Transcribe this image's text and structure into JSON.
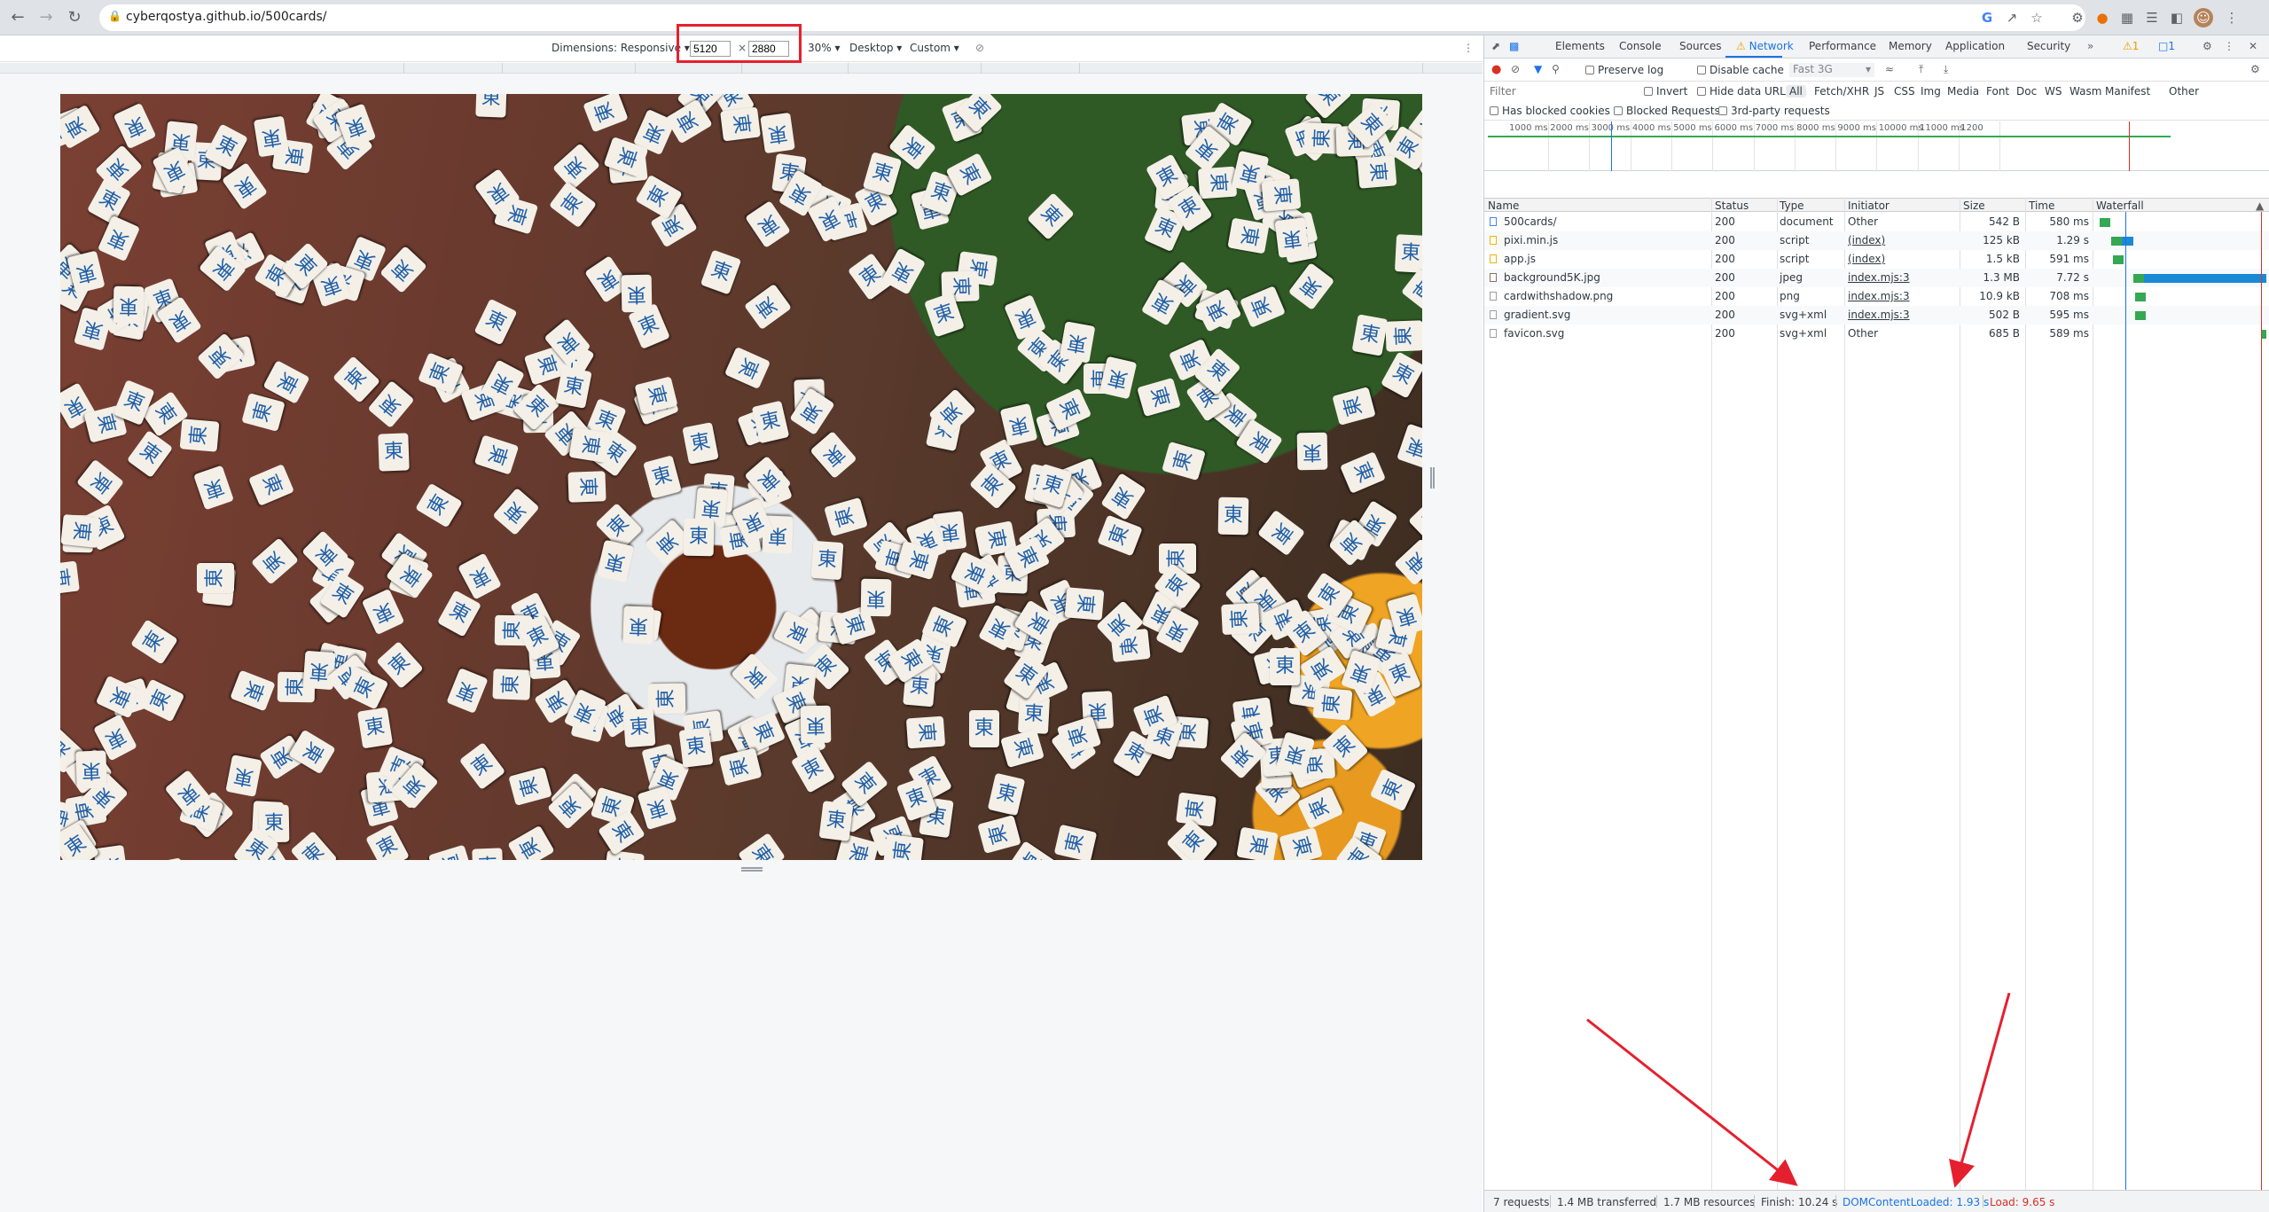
{
  "browser": {
    "url": "cyberqostya.github.io/500cards/"
  },
  "device_toolbar": {
    "dimensions_label": "Dimensions: Responsive ▾",
    "width": "5120",
    "height": "2880",
    "times": "×",
    "zoom": "30% ▾",
    "device_type": "Desktop ▾",
    "throttle": "Custom ▾"
  },
  "page": {
    "tile_glyph": "東",
    "background_colors": {
      "table": "#6a3a2e",
      "tile": "#f4f0e8",
      "glyph": "#1f5fa8"
    }
  },
  "devtools": {
    "tabs": [
      "Elements",
      "Console",
      "Sources",
      "Network",
      "Performance",
      "Memory",
      "Application",
      "Security"
    ],
    "active_tab": "Network",
    "warning_count": "1",
    "message_count": "1",
    "preserve_log": "Preserve log",
    "disable_cache": "Disable cache",
    "throttling": "Fast 3G",
    "filter_placeholder": "Filter",
    "invert": "Invert",
    "hide_data_urls": "Hide data URLs",
    "type_filters": [
      "All",
      "Fetch/XHR",
      "JS",
      "CSS",
      "Img",
      "Media",
      "Font",
      "Doc",
      "WS",
      "Wasm",
      "Manifest",
      "Other"
    ],
    "has_blocked_cookies": "Has blocked cookies",
    "blocked_requests": "Blocked Requests",
    "third_party": "3rd-party requests",
    "overview_ticks": [
      "1000 ms",
      "2000 ms",
      "3000 ms",
      "4000 ms",
      "5000 ms",
      "6000 ms",
      "7000 ms",
      "8000 ms",
      "9000 ms",
      "10000 ms",
      "11000 ms",
      "1200"
    ],
    "columns": [
      "Name",
      "Status",
      "Type",
      "Initiator",
      "Size",
      "Time",
      "Waterfall"
    ],
    "requests": [
      {
        "name": "500cards/",
        "status": "200",
        "type": "document",
        "initiator": "Other",
        "size": "542 B",
        "time": "580 ms",
        "icon_color": "#4285f4",
        "wf_start": 0.02,
        "wf_end": 0.09
      },
      {
        "name": "pixi.min.js",
        "status": "200",
        "type": "script",
        "initiator": "(index)",
        "size": "125 kB",
        "time": "1.29 s",
        "icon_color": "#f4b400",
        "wf_start": 0.09,
        "wf_end": 0.22
      },
      {
        "name": "app.js",
        "status": "200",
        "type": "script",
        "initiator": "(index)",
        "size": "1.5 kB",
        "time": "591 ms",
        "icon_color": "#f4b400",
        "wf_start": 0.1,
        "wf_end": 0.16
      },
      {
        "name": "background5K.jpg",
        "status": "200",
        "type": "jpeg",
        "initiator": "index.mjs:3",
        "size": "1.3 MB",
        "time": "7.72 s",
        "icon_color": "#8d6e63",
        "wf_start": 0.22,
        "wf_end": 1.0
      },
      {
        "name": "cardwithshadow.png",
        "status": "200",
        "type": "png",
        "initiator": "index.mjs:3",
        "size": "10.9 kB",
        "time": "708 ms",
        "icon_color": "#9e9e9e",
        "wf_start": 0.23,
        "wf_end": 0.3
      },
      {
        "name": "gradient.svg",
        "status": "200",
        "type": "svg+xml",
        "initiator": "index.mjs:3",
        "size": "502 B",
        "time": "595 ms",
        "icon_color": "#9e9e9e",
        "wf_start": 0.23,
        "wf_end": 0.29
      },
      {
        "name": "favicon.svg",
        "status": "200",
        "type": "svg+xml",
        "initiator": "Other",
        "size": "685 B",
        "time": "589 ms",
        "icon_color": "#9e9e9e",
        "wf_start": 0.97,
        "wf_end": 1.0
      }
    ],
    "status_bar": {
      "requests": "7 requests",
      "transferred": "1.4 MB transferred",
      "resources": "1.7 MB resources",
      "finish": "Finish: 10.24 s",
      "dom_content_loaded": "DOMContentLoaded: 1.93 s",
      "load": "Load: 9.65 s"
    }
  }
}
